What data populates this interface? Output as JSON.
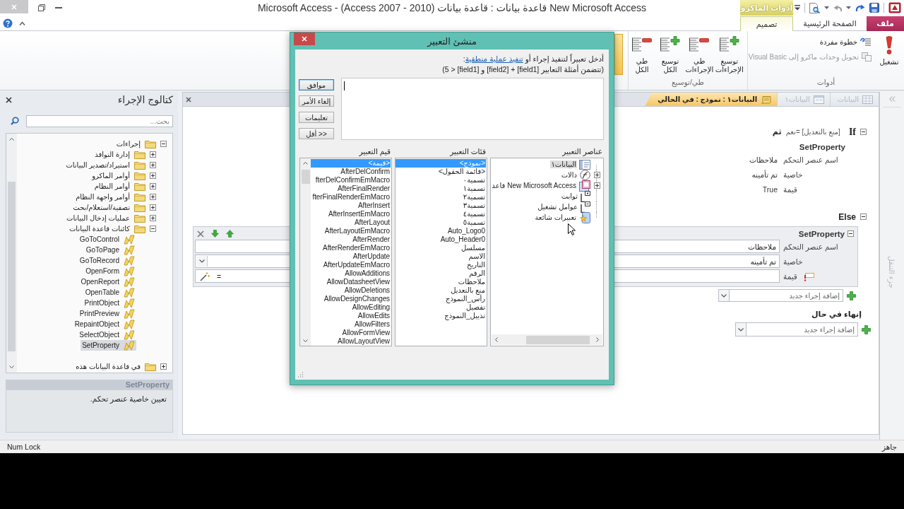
{
  "window": {
    "title": "Microsoft Access - (Access 2007 - 2010) قاعدة بيانات : قاعدة بيانات New Microsoft Access"
  },
  "ribbon": {
    "contextual_header": "أدوات الماكرو",
    "tabs": [
      {
        "label": "ملف",
        "kind": "file",
        "selected": false
      },
      {
        "label": "الصفحة الرئيسية",
        "kind": "normal",
        "selected": false
      },
      {
        "label": "تصميم",
        "kind": "contextual",
        "selected": true
      }
    ],
    "groups": [
      {
        "label": "أدوات",
        "kind": "tools",
        "buttons": [
          {
            "label": "تشغيل",
            "kind": "run",
            "disabled": false
          },
          {
            "label": "خطوة مفردة",
            "kind": "single-step",
            "disabled": false
          },
          {
            "label": "تحويل وحدات ماكرو إلى Visual Basic",
            "kind": "convert",
            "disabled": true
          }
        ]
      },
      {
        "label": "طي/توسيع",
        "kind": "collapse",
        "buttons": [
          {
            "label": "توسيع الإجراءات",
            "kind": "expand",
            "disabled": false
          },
          {
            "label": "طي الإجراءات",
            "kind": "collapse",
            "disabled": false
          },
          {
            "label": "توسيع الكل",
            "kind": "expand",
            "disabled": false
          },
          {
            "label": "طي الكل",
            "kind": "collapse",
            "disabled": false
          }
        ]
      }
    ]
  },
  "catalog": {
    "title": "كتالوج الإجراء",
    "search": {
      "placeholder": "بحث..."
    },
    "tree": [
      {
        "label": "إجراءات",
        "kind": "folder",
        "expanded": true,
        "selected": false,
        "children": [
          {
            "label": "إدارة النوافذ",
            "kind": "folder",
            "expanded": false,
            "selected": false
          },
          {
            "label": "استيراد/تصدير البيانات",
            "kind": "folder",
            "expanded": false,
            "selected": false
          },
          {
            "label": "أوامر الماكرو",
            "kind": "folder",
            "expanded": false,
            "selected": false
          },
          {
            "label": "أوامر النظام",
            "kind": "folder",
            "expanded": false,
            "selected": false
          },
          {
            "label": "أوامر واجهة النظام",
            "kind": "folder",
            "expanded": false,
            "selected": false
          },
          {
            "label": "تصفية/استعلام/بحث",
            "kind": "folder",
            "expanded": false,
            "selected": false
          },
          {
            "label": "عمليات إدخال البيانات",
            "kind": "folder",
            "expanded": false,
            "selected": false
          },
          {
            "label": "كائنات قاعدة البيانات",
            "kind": "folder",
            "expanded": true,
            "selected": false,
            "children": [
              {
                "label": "GoToControl",
                "kind": "action",
                "selected": false
              },
              {
                "label": "GoToPage",
                "kind": "action",
                "selected": false
              },
              {
                "label": "GoToRecord",
                "kind": "action",
                "selected": false
              },
              {
                "label": "OpenForm",
                "kind": "action",
                "selected": false
              },
              {
                "label": "OpenReport",
                "kind": "action",
                "selected": false
              },
              {
                "label": "OpenTable",
                "kind": "action",
                "selected": false
              },
              {
                "label": "PrintObject",
                "kind": "action",
                "selected": false
              },
              {
                "label": "PrintPreview",
                "kind": "action",
                "selected": false
              },
              {
                "label": "RepaintObject",
                "kind": "action",
                "selected": false
              },
              {
                "label": "SelectObject",
                "kind": "action",
                "selected": false
              },
              {
                "label": "SetProperty",
                "kind": "action",
                "selected": true
              }
            ]
          }
        ]
      },
      {
        "label": "في قاعدة البيانات هذه",
        "kind": "folder",
        "expanded": false,
        "selected": false
      }
    ],
    "description": {
      "title": "SetProperty",
      "text": "تعيين خاصية عنصر تحكم."
    }
  },
  "document": {
    "tabs": [
      {
        "label": "البيانات",
        "kind": "table",
        "selected": false
      },
      {
        "label": "البيانات١",
        "kind": "form",
        "selected": false
      },
      {
        "label": "البيانات١ : نموذج : في الحالي",
        "kind": "macro",
        "selected": true
      }
    ]
  },
  "macro": {
    "blocks": [
      {
        "kind": "if",
        "keyword": "If",
        "condition": "[منع بالتعديل] =نعم",
        "then": "ثم",
        "expanded": true,
        "actions": [
          {
            "name": "SetProperty",
            "selected": false,
            "arguments": [
              {
                "label": "اسم عنصر التحكم",
                "value": "ملاحظات",
                "error": false
              },
              {
                "label": "خاصية",
                "value": "تم تأمينه",
                "error": false
              },
              {
                "label": "قيمة",
                "value": "True",
                "error": false
              }
            ]
          }
        ]
      },
      {
        "kind": "else",
        "keyword": "Else",
        "expanded": true,
        "actions": [
          {
            "name": "SetProperty",
            "selected": true,
            "arguments": [
              {
                "label": "اسم عنصر التحكم",
                "value": "ملاحظات",
                "kind": "text",
                "error": false
              },
              {
                "label": "خاصية",
                "value": "تم تأمينه",
                "kind": "dropdown",
                "error": false
              },
              {
                "label": "قيمة",
                "value": "=",
                "kind": "expression",
                "error": true
              }
            ]
          }
        ],
        "add_action": {
          "placeholder": "إضافة إجراء جديد"
        }
      }
    ],
    "end_if": "إنهاء في حال",
    "add_action": {
      "placeholder": "إضافة إجراء جديد"
    }
  },
  "navigation_pane": {
    "title": "جزء التنقل"
  },
  "expression_builder": {
    "title": "منشئ التعبير",
    "instruction": {
      "text": "أدخل تعبيراً لتنفيذ إجراء أو ",
      "link": "تنفيذ عملية منطقية",
      "suffix": ":"
    },
    "example": "(تتضمن أمثلة التعابير [field1] + [field2] و [field1] < 5)",
    "buttons": [
      {
        "label": "موافق",
        "default": true
      },
      {
        "label": "إلغاء الأمر",
        "default": false
      },
      {
        "label": "تعليمات",
        "default": false
      },
      {
        "label": "<< أقل",
        "default": false
      }
    ],
    "panes": [
      {
        "heading": "عناصر التعبير",
        "kind": "tree",
        "items": [
          {
            "label": "البيانات١",
            "kind": "form",
            "selected": true
          },
          {
            "label": "دالات",
            "kind": "functions",
            "selected": false,
            "expanded": false
          },
          {
            "label": "New Microsoft Access قاعد",
            "kind": "database",
            "selected": false,
            "expanded": false
          },
          {
            "label": "ثوابت",
            "kind": "constants",
            "selected": false
          },
          {
            "label": "عوامل تشغيل",
            "kind": "operators",
            "selected": false
          },
          {
            "label": "تعبيرات شائعة",
            "kind": "common",
            "selected": false
          }
        ]
      },
      {
        "heading": "فئات التعبير",
        "kind": "list",
        "items": [
          {
            "label": "<نموذج>",
            "selected": true
          },
          {
            "label": "<قائمة الحقول>",
            "selected": false
          },
          {
            "label": "تسمية٠",
            "selected": false
          },
          {
            "label": "تسمية١",
            "selected": false
          },
          {
            "label": "تسمية٢",
            "selected": false
          },
          {
            "label": "تسمية٣",
            "selected": false
          },
          {
            "label": "تسمية٤",
            "selected": false
          },
          {
            "label": "تسمية٥",
            "selected": false
          },
          {
            "label": "Auto_Logo0",
            "selected": false
          },
          {
            "label": "Auto_Header0",
            "selected": false
          },
          {
            "label": "مسلسل",
            "selected": false
          },
          {
            "label": "الاسم",
            "selected": false
          },
          {
            "label": "التاريخ",
            "selected": false
          },
          {
            "label": "الرقم",
            "selected": false
          },
          {
            "label": "ملاحظات",
            "selected": false
          },
          {
            "label": "منع بالتعديل",
            "selected": false
          },
          {
            "label": "رأس_النموذج",
            "selected": false
          },
          {
            "label": "تفصيل",
            "selected": false
          },
          {
            "label": "تذييل_النموذج",
            "selected": false
          }
        ]
      },
      {
        "heading": "قيم التعبير",
        "kind": "list",
        "items": [
          {
            "label": "<قيمة>",
            "selected": true
          },
          {
            "label": "AfterDelConfirm",
            "selected": false
          },
          {
            "label": "fterDelConfirmEmMacro",
            "selected": false
          },
          {
            "label": "AfterFinalRender",
            "selected": false
          },
          {
            "label": "fterFinalRenderEmMacro",
            "selected": false
          },
          {
            "label": "AfterInsert",
            "selected": false
          },
          {
            "label": "AfterInsertEmMacro",
            "selected": false
          },
          {
            "label": "AfterLayout",
            "selected": false
          },
          {
            "label": "AfterLayoutEmMacro",
            "selected": false
          },
          {
            "label": "AfterRender",
            "selected": false
          },
          {
            "label": "AfterRenderEmMacro",
            "selected": false
          },
          {
            "label": "AfterUpdate",
            "selected": false
          },
          {
            "label": "AfterUpdateEmMacro",
            "selected": false
          },
          {
            "label": "AllowAdditions",
            "selected": false
          },
          {
            "label": "AllowDatasheetView",
            "selected": false
          },
          {
            "label": "AllowDeletions",
            "selected": false
          },
          {
            "label": "AllowDesignChanges",
            "selected": false
          },
          {
            "label": "AllowEditing",
            "selected": false
          },
          {
            "label": "AllowEdits",
            "selected": false
          },
          {
            "label": "AllowFilters",
            "selected": false
          },
          {
            "label": "AllowFormView",
            "selected": false
          },
          {
            "label": "AllowLayoutView",
            "selected": false
          }
        ]
      }
    ]
  },
  "status_bar": {
    "indicators": [
      "Num Lock"
    ],
    "message": "جاهز"
  }
}
